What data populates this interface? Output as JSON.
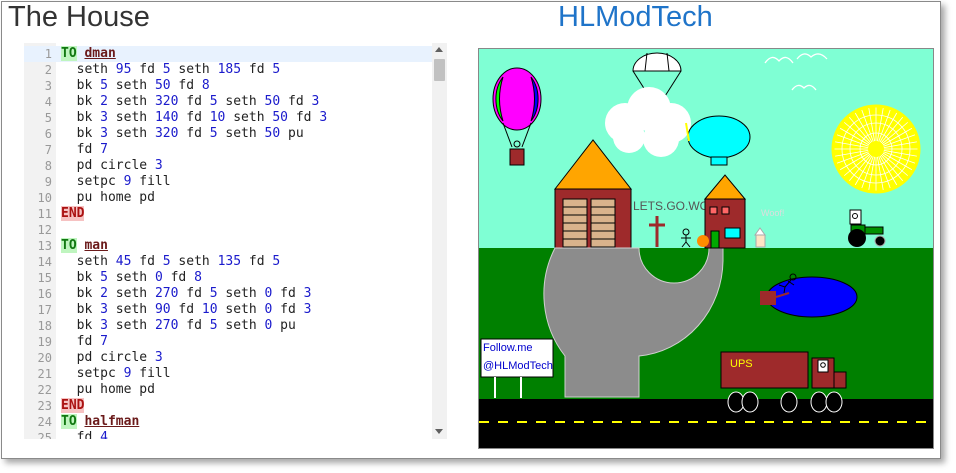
{
  "page": {
    "left_title": "The House",
    "right_title": "HLModTech"
  },
  "editor": {
    "lines": [
      {
        "n": "1",
        "tokens": [
          {
            "t": "TO",
            "c": "kw-to"
          },
          {
            "t": " "
          },
          {
            "t": "dman",
            "c": "pname"
          }
        ]
      },
      {
        "n": "2",
        "tokens": [
          {
            "t": "  seth "
          },
          {
            "t": "95",
            "c": "num"
          },
          {
            "t": " fd "
          },
          {
            "t": "5",
            "c": "num"
          },
          {
            "t": " seth "
          },
          {
            "t": "185",
            "c": "num"
          },
          {
            "t": " fd "
          },
          {
            "t": "5",
            "c": "num"
          }
        ]
      },
      {
        "n": "3",
        "tokens": [
          {
            "t": "  bk "
          },
          {
            "t": "5",
            "c": "num"
          },
          {
            "t": " seth "
          },
          {
            "t": "50",
            "c": "num"
          },
          {
            "t": " fd "
          },
          {
            "t": "8",
            "c": "num"
          }
        ]
      },
      {
        "n": "4",
        "tokens": [
          {
            "t": "  bk "
          },
          {
            "t": "2",
            "c": "num"
          },
          {
            "t": " seth "
          },
          {
            "t": "320",
            "c": "num"
          },
          {
            "t": " fd "
          },
          {
            "t": "5",
            "c": "num"
          },
          {
            "t": " seth "
          },
          {
            "t": "50",
            "c": "num"
          },
          {
            "t": " fd "
          },
          {
            "t": "3",
            "c": "num"
          }
        ]
      },
      {
        "n": "5",
        "tokens": [
          {
            "t": "  bk "
          },
          {
            "t": "3",
            "c": "num"
          },
          {
            "t": " seth "
          },
          {
            "t": "140",
            "c": "num"
          },
          {
            "t": " fd "
          },
          {
            "t": "10",
            "c": "num"
          },
          {
            "t": " seth "
          },
          {
            "t": "50",
            "c": "num"
          },
          {
            "t": " fd "
          },
          {
            "t": "3",
            "c": "num"
          }
        ]
      },
      {
        "n": "6",
        "tokens": [
          {
            "t": "  bk "
          },
          {
            "t": "3",
            "c": "num"
          },
          {
            "t": " seth "
          },
          {
            "t": "320",
            "c": "num"
          },
          {
            "t": " fd "
          },
          {
            "t": "5",
            "c": "num"
          },
          {
            "t": " seth "
          },
          {
            "t": "50",
            "c": "num"
          },
          {
            "t": " pu"
          }
        ]
      },
      {
        "n": "7",
        "tokens": [
          {
            "t": "  fd "
          },
          {
            "t": "7",
            "c": "num"
          }
        ]
      },
      {
        "n": "8",
        "tokens": [
          {
            "t": "  pd circle "
          },
          {
            "t": "3",
            "c": "num"
          }
        ]
      },
      {
        "n": "9",
        "tokens": [
          {
            "t": "  setpc "
          },
          {
            "t": "9",
            "c": "num"
          },
          {
            "t": " fill"
          }
        ]
      },
      {
        "n": "10",
        "tokens": [
          {
            "t": "  pu home pd"
          }
        ]
      },
      {
        "n": "11",
        "tokens": [
          {
            "t": "END",
            "c": "kw-end"
          }
        ]
      },
      {
        "n": "12",
        "tokens": []
      },
      {
        "n": "13",
        "tokens": [
          {
            "t": "TO",
            "c": "kw-to"
          },
          {
            "t": " "
          },
          {
            "t": "man",
            "c": "pname"
          }
        ]
      },
      {
        "n": "14",
        "tokens": [
          {
            "t": "  seth "
          },
          {
            "t": "45",
            "c": "num"
          },
          {
            "t": " fd "
          },
          {
            "t": "5",
            "c": "num"
          },
          {
            "t": " seth "
          },
          {
            "t": "135",
            "c": "num"
          },
          {
            "t": " fd "
          },
          {
            "t": "5",
            "c": "num"
          }
        ]
      },
      {
        "n": "15",
        "tokens": [
          {
            "t": "  bk "
          },
          {
            "t": "5",
            "c": "num"
          },
          {
            "t": " seth "
          },
          {
            "t": "0",
            "c": "num"
          },
          {
            "t": " fd "
          },
          {
            "t": "8",
            "c": "num"
          }
        ]
      },
      {
        "n": "16",
        "tokens": [
          {
            "t": "  bk "
          },
          {
            "t": "2",
            "c": "num"
          },
          {
            "t": " seth "
          },
          {
            "t": "270",
            "c": "num"
          },
          {
            "t": " fd "
          },
          {
            "t": "5",
            "c": "num"
          },
          {
            "t": " seth "
          },
          {
            "t": "0",
            "c": "num"
          },
          {
            "t": " fd "
          },
          {
            "t": "3",
            "c": "num"
          }
        ]
      },
      {
        "n": "17",
        "tokens": [
          {
            "t": "  bk "
          },
          {
            "t": "3",
            "c": "num"
          },
          {
            "t": " seth "
          },
          {
            "t": "90",
            "c": "num"
          },
          {
            "t": " fd "
          },
          {
            "t": "10",
            "c": "num"
          },
          {
            "t": " seth "
          },
          {
            "t": "0",
            "c": "num"
          },
          {
            "t": " fd "
          },
          {
            "t": "3",
            "c": "num"
          }
        ]
      },
      {
        "n": "18",
        "tokens": [
          {
            "t": "  bk "
          },
          {
            "t": "3",
            "c": "num"
          },
          {
            "t": " seth "
          },
          {
            "t": "270",
            "c": "num"
          },
          {
            "t": " fd "
          },
          {
            "t": "5",
            "c": "num"
          },
          {
            "t": " seth "
          },
          {
            "t": "0",
            "c": "num"
          },
          {
            "t": " pu"
          }
        ]
      },
      {
        "n": "19",
        "tokens": [
          {
            "t": "  fd "
          },
          {
            "t": "7",
            "c": "num"
          }
        ]
      },
      {
        "n": "20",
        "tokens": [
          {
            "t": "  pd circle "
          },
          {
            "t": "3",
            "c": "num"
          }
        ]
      },
      {
        "n": "21",
        "tokens": [
          {
            "t": "  setpc "
          },
          {
            "t": "9",
            "c": "num"
          },
          {
            "t": " fill"
          }
        ]
      },
      {
        "n": "22",
        "tokens": [
          {
            "t": "  pu home pd"
          }
        ]
      },
      {
        "n": "23",
        "tokens": [
          {
            "t": "END",
            "c": "kw-end"
          }
        ]
      },
      {
        "n": "24",
        "tokens": [
          {
            "t": "TO",
            "c": "kw-to"
          },
          {
            "t": " "
          },
          {
            "t": "halfman",
            "c": "pname"
          }
        ]
      },
      {
        "n": "25",
        "tokens": [
          {
            "t": "  fd "
          },
          {
            "t": "4",
            "c": "num"
          }
        ]
      }
    ]
  },
  "scene": {
    "sign_text": "LETS.GO.WO!",
    "dog_text": "Woof!",
    "follow_line1": "Follow.me",
    "follow_line2": "@HLModTech",
    "truck_text": "UPS",
    "colors": {
      "sky": "#7fffd4",
      "grass": "#008000",
      "road": "#000000",
      "road_line": "#ffff00",
      "path": "#8c8c8c",
      "house": "#9e2a2b",
      "roof": "#ffa500",
      "pond": "#0000ff",
      "sun": "#ffff00",
      "blimp": "#00ffff",
      "balloon": "#ff00ff"
    }
  }
}
